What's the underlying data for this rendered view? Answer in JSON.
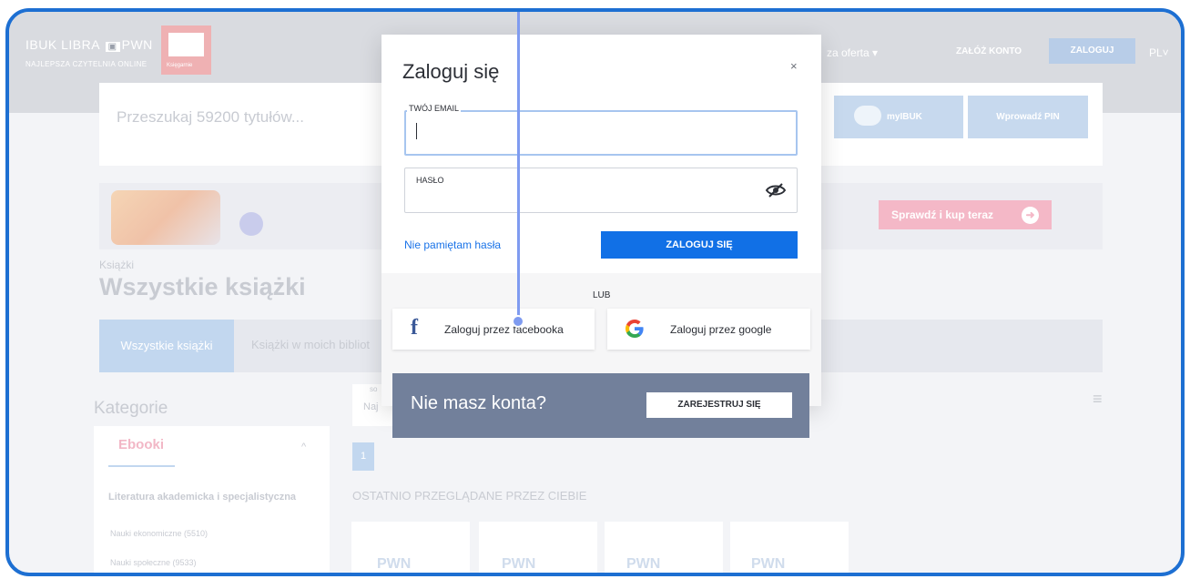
{
  "header": {
    "logo_text": "IBUK LIBRA",
    "logo_pwn": "PWN",
    "logo_sub": "NAJLEPSZA CZYTELNIA ONLINE",
    "red_logo_text": "Księgarnie",
    "nav_offer": "za oferta ▾",
    "nav_register": "ZAŁÓŻ KONTO",
    "nav_login": "ZALOGUJ",
    "nav_lang": "PL˅"
  },
  "search": {
    "placeholder": "Przeszukaj 59200 tytułów...",
    "mybtn_label": "myIBUK",
    "pin_label": "Wprowadź PIN"
  },
  "banner": {
    "cta_label": "Sprawdź i kup teraz",
    "letter": "["
  },
  "page": {
    "breadcrumb": "Książki",
    "title": "Wszystkie książki",
    "tab_active": "Wszystkie książki",
    "tab_2": "Książki w moich bibliot",
    "categories_title": "Kategorie",
    "ebooki": "Ebooki",
    "category_head": "Literatura akademicka i specjalistyczna",
    "cat_item1": "Nauki ekonomiczne (5510)",
    "cat_item2": "Nauki społeczne (9533)",
    "sort_label": "so",
    "sort_value": "Naj",
    "page_number": "1",
    "recent_title": "OSTATNIO PRZEGLĄDANE PRZEZ CIEBIE",
    "thumb_logo": "PWN"
  },
  "modal": {
    "title": "Zaloguj się",
    "close": "×",
    "email_label": "TWÓJ EMAIL",
    "password_label": "HASŁO",
    "forgot": "Nie pamiętam hasła",
    "login_button": "ZALOGUJ SIĘ",
    "or": "LUB",
    "facebook_button": "Zaloguj przez facebooka",
    "google_button": "Zaloguj przez google",
    "no_account": "Nie masz konta?",
    "register_button": "ZAREJESTRUJ SIĘ"
  },
  "colors": {
    "accent": "#1170e6",
    "frame": "#1d6fd2",
    "pointer": "#7f9bf0",
    "facebook": "#3b5998",
    "register_panel": "#72809b"
  }
}
